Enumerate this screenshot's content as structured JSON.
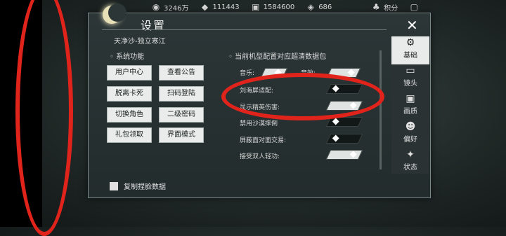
{
  "hud": {
    "currency1": "3246万",
    "currency2": "111443",
    "currency3": "1584600",
    "currency4": "686",
    "points_label": "积分"
  },
  "dialog": {
    "title": "设置",
    "server": "天净沙-独立寒江",
    "close_symbol": "✕"
  },
  "system": {
    "section_label": "系统功能",
    "buttons": [
      "用户中心",
      "查看公告",
      "脱离卡死",
      "扫码登陆",
      "切换角色",
      "二级密码",
      "礼包领取",
      "界面模式"
    ]
  },
  "hd": {
    "section_label": "当前机型配置对应超清数据包"
  },
  "settings": [
    {
      "label": "音乐:",
      "label2": "音效:",
      "state": "on"
    },
    {
      "label": "刘海屏适配:",
      "state": "off"
    },
    {
      "label": "显示精英伤害:",
      "state": "on"
    },
    {
      "label": "禁用沙漠摔倒",
      "state": "off"
    },
    {
      "label": "屏蔽面对面交易:",
      "state": "off"
    },
    {
      "label": "接受双人轻功:",
      "state": "on"
    }
  ],
  "tabs": [
    {
      "label": "基础",
      "icon": "gear-icon",
      "active": true
    },
    {
      "label": "镜头",
      "icon": "camera-icon",
      "active": false
    },
    {
      "label": "画质",
      "icon": "monitor-icon",
      "active": false
    },
    {
      "label": "偏好",
      "icon": "person-icon",
      "active": false
    },
    {
      "label": "状态",
      "icon": "status-icon",
      "active": false
    }
  ],
  "footer": {
    "copy_face": "复制捏脸数据"
  }
}
